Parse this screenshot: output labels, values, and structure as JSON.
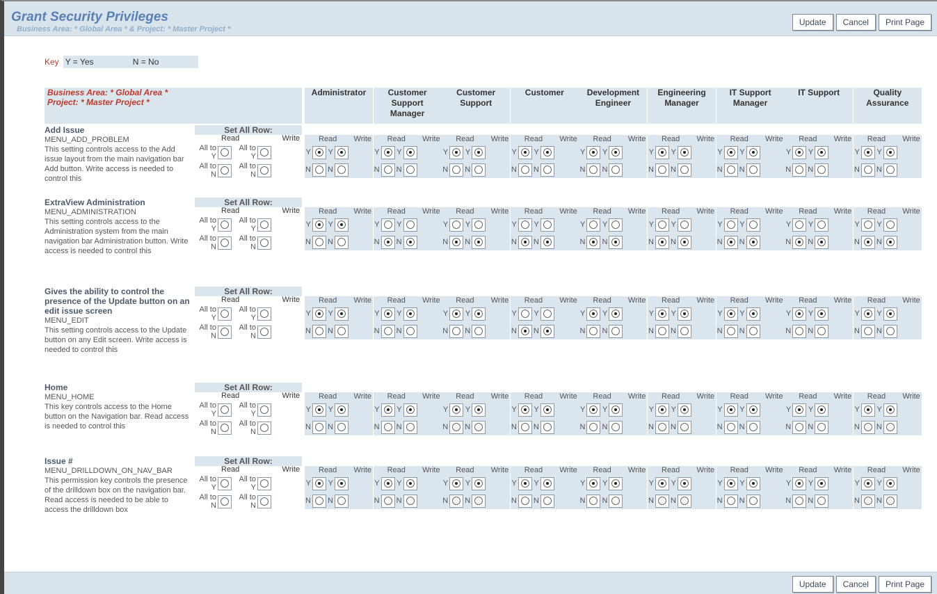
{
  "page": {
    "title": "Grant Security Privileges",
    "subtitle": "Business Area: * Global Area * & Project: * Master Project *"
  },
  "buttons": {
    "update": "Update",
    "cancel": "Cancel",
    "print": "Print Page"
  },
  "key": {
    "label": "Key",
    "yes": "Y = Yes",
    "no": "N = No"
  },
  "header": {
    "business_area": "Business Area: * Global Area *",
    "project": "Project: * Master Project *"
  },
  "labels": {
    "set_all_row": "Set All Row:",
    "read": "Read",
    "write": "Write",
    "all_to_y": "All to Y",
    "all_to_n": "All to N",
    "y": "Y",
    "n": "N"
  },
  "roles": [
    "Administrator",
    "Customer Support Manager",
    "Customer Support",
    "Customer",
    "Development Engineer",
    "Engineering Manager",
    "IT Support Manager",
    "IT Support",
    "Quality Assurance"
  ],
  "rows": [
    {
      "title": "Add Issue",
      "key": "MENU_ADD_PROBLEM",
      "description": "This setting controls access to the Add issue layout from the main navigation bar Add button. Write access is needed to control this",
      "perms": [
        [
          "Y",
          "Y"
        ],
        [
          "Y",
          "Y"
        ],
        [
          "Y",
          "Y"
        ],
        [
          "Y",
          "Y"
        ],
        [
          "Y",
          "Y"
        ],
        [
          "Y",
          "Y"
        ],
        [
          "Y",
          "Y"
        ],
        [
          "Y",
          "Y"
        ],
        [
          "Y",
          "Y"
        ]
      ]
    },
    {
      "title": "ExtraView Administration",
      "key": "MENU_ADMINISTRATION",
      "description": "This setting controls access to the Administration system from the main navigation bar Administration button. Write access is needed to control this",
      "perms": [
        [
          "Y",
          "Y"
        ],
        [
          "N",
          "N"
        ],
        [
          "N",
          "N"
        ],
        [
          "N",
          "N"
        ],
        [
          "N",
          "N"
        ],
        [
          "N",
          "N"
        ],
        [
          "N",
          "N"
        ],
        [
          "N",
          "N"
        ],
        [
          "N",
          "N"
        ]
      ]
    },
    {
      "title": "Gives the ability to control the presence of the Update button on an edit issue screen",
      "key": "MENU_EDIT",
      "description": "This setting controls access to the Update button on any Edit screen. Write access is needed to control this",
      "perms": [
        [
          "Y",
          "Y"
        ],
        [
          "Y",
          "Y"
        ],
        [
          "Y",
          "Y"
        ],
        [
          "N",
          "N"
        ],
        [
          "Y",
          "Y"
        ],
        [
          "Y",
          "Y"
        ],
        [
          "Y",
          "Y"
        ],
        [
          "Y",
          "Y"
        ],
        [
          "Y",
          "Y"
        ]
      ]
    },
    {
      "title": "Home",
      "key": "MENU_HOME",
      "description": "This key controls access to the Home button on the Navigation bar. Read access is needed to control this",
      "perms": [
        [
          "Y",
          "Y"
        ],
        [
          "Y",
          "Y"
        ],
        [
          "Y",
          "Y"
        ],
        [
          "Y",
          "Y"
        ],
        [
          "Y",
          "Y"
        ],
        [
          "Y",
          "Y"
        ],
        [
          "Y",
          "Y"
        ],
        [
          "Y",
          "Y"
        ],
        [
          "Y",
          "Y"
        ]
      ]
    },
    {
      "title": "Issue #",
      "key": "MENU_DRILLDOWN_ON_NAV_BAR",
      "description": "This permission key controls the presence of the drilldown box on the navigation bar. Read access is needed to be able to access the drilldown box",
      "perms": [
        [
          "Y",
          "Y"
        ],
        [
          "Y",
          "Y"
        ],
        [
          "Y",
          "Y"
        ],
        [
          "Y",
          "Y"
        ],
        [
          "Y",
          "Y"
        ],
        [
          "Y",
          "Y"
        ],
        [
          "Y",
          "Y"
        ],
        [
          "Y",
          "Y"
        ],
        [
          "Y",
          "Y"
        ]
      ]
    }
  ]
}
